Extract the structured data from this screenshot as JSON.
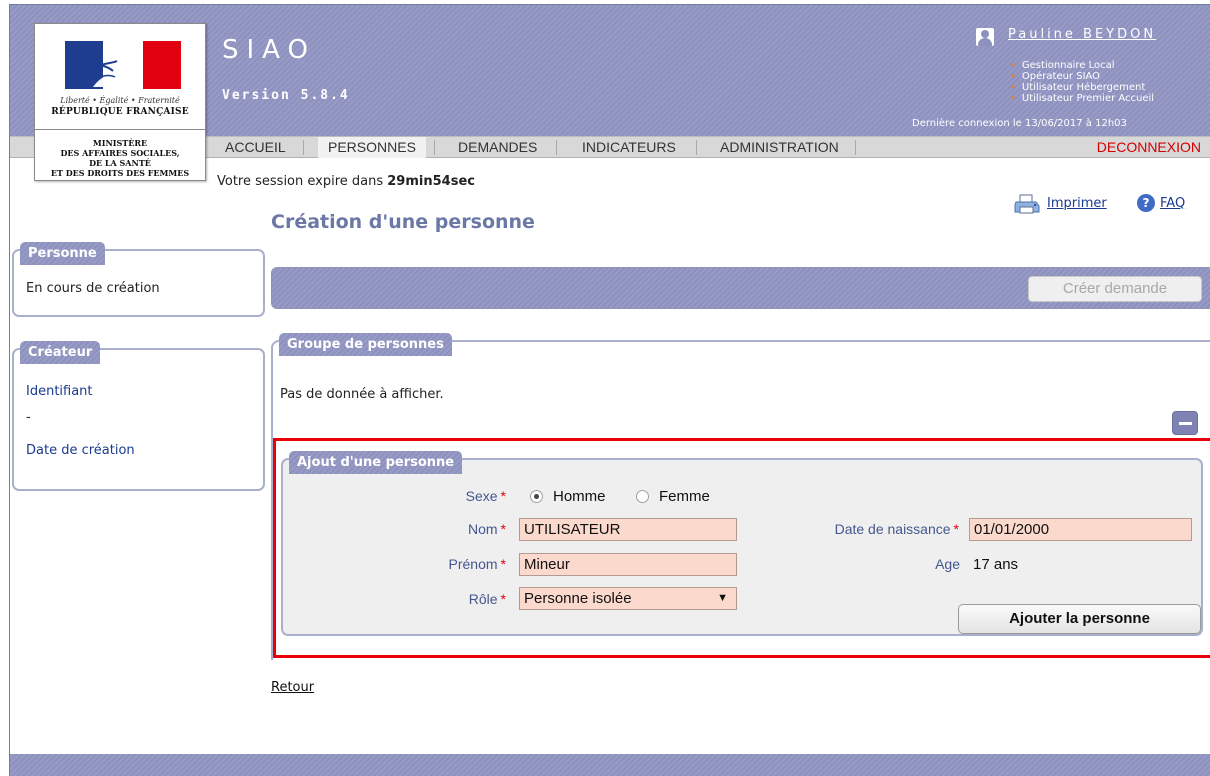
{
  "header": {
    "app_title": "SIAO",
    "version": "Version 5.8.4",
    "logo": {
      "motto": "Liberté • Égalité • Fraternité",
      "republic": "RÉPUBLIQUE FRANÇAISE",
      "ministry_lines": [
        "MINISTÈRE",
        "DES AFFAIRES SOCIALES,",
        "DE LA SANTÉ",
        "ET DES DROITS DES FEMMES"
      ]
    },
    "user_name": "Pauline BEYDON",
    "roles": [
      "Gestionnaire Local",
      "Opérateur SIAO",
      "Utilisateur Hébergement",
      "Utilisateur Premier Accueil"
    ],
    "last_connection": "Dernière connexion le 13/06/2017 à 12h03"
  },
  "nav": {
    "items": [
      {
        "label": "ACCUEIL",
        "active": false
      },
      {
        "label": "PERSONNES",
        "active": true
      },
      {
        "label": "DEMANDES",
        "active": false
      },
      {
        "label": "INDICATEURS",
        "active": false
      },
      {
        "label": "ADMINISTRATION",
        "active": false
      }
    ],
    "logout": "DECONNEXION"
  },
  "session": {
    "prefix": "Votre session expire dans ",
    "remaining": "29min54sec"
  },
  "links": {
    "print": "Imprimer",
    "faq": "FAQ"
  },
  "page_title": "Création d'une personne",
  "sidebar": {
    "person": {
      "title": "Personne",
      "status": "En cours de création"
    },
    "creator": {
      "title": "Créateur",
      "id_label": "Identifiant",
      "id_value": "-",
      "date_label": "Date de création"
    }
  },
  "toolbar": {
    "create_request": "Créer demande"
  },
  "group": {
    "title": "Groupe de personnes",
    "empty": "Pas de donnée à afficher."
  },
  "add_person": {
    "title": "Ajout d'une personne",
    "sexe_label": "Sexe",
    "sexe_options": [
      "Homme",
      "Femme"
    ],
    "sexe_selected": "Homme",
    "nom_label": "Nom",
    "nom_value": "UTILISATEUR",
    "prenom_label": "Prénom",
    "prenom_value": "Mineur",
    "role_label": "Rôle",
    "role_value": "Personne isolée",
    "birth_label": "Date de naissance",
    "birth_value": "01/01/2000",
    "age_label": "Age",
    "age_value": "17 ans",
    "submit": "Ajouter la personne",
    "required_mark": "*"
  },
  "retour": "Retour",
  "colors": {
    "header": "#8d91bd",
    "required": "#e8000b",
    "field_bg": "#fcd9cd",
    "title": "#6b78a6",
    "highlight_border": "#e8000b"
  },
  "icons": [
    "user-icon",
    "print-icon",
    "help-icon",
    "minus-icon",
    "dropdown-arrow-icon"
  ]
}
